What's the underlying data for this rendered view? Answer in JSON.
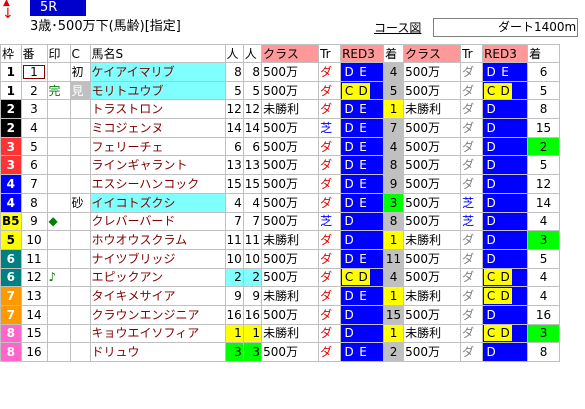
{
  "race": {
    "number": "5R",
    "condition": "3歳･500万下(馬齢)[指定]",
    "course_link": "コース図",
    "course": "ダート1400m"
  },
  "headers": [
    "枠",
    "番",
    "印",
    "C",
    "馬名S",
    "人",
    "人",
    "クラス",
    "Tr",
    "RED3",
    "着",
    "クラス",
    "Tr",
    "RED3",
    "着"
  ],
  "rows": [
    {
      "waku": "1",
      "waku_bg": "#ffffff",
      "waku_fg": "#000000",
      "ban": "1",
      "mark": "",
      "c": "初",
      "name": "ケイアイマリブ",
      "name_hl": "hl",
      "r1": "8",
      "r2": "8",
      "cls1": "500万",
      "tr1": "ダ",
      "red1": [
        "D",
        "E"
      ],
      "pos1": "4",
      "pos1_bg": "#c0c0c0",
      "cls2": "500万",
      "tr2": "ダ",
      "red2": [
        "D",
        "E"
      ],
      "pos2": "6",
      "pos2_bg": "#ffffff"
    },
    {
      "waku": "1",
      "waku_bg": "#ffffff",
      "waku_fg": "#000000",
      "ban": "2",
      "mark": "完",
      "c": "見",
      "name": "モリトユウブ",
      "name_hl": "hl",
      "r1": "5",
      "r2": "5",
      "cls1": "500万",
      "tr1": "ダ",
      "red1": [
        "C",
        "D"
      ],
      "pos1": "5",
      "pos1_bg": "#c0c0c0",
      "cls2": "500万",
      "tr2": "ダ",
      "red2": [
        "C",
        "D"
      ],
      "pos2": "5",
      "pos2_bg": "#ffffff"
    },
    {
      "waku": "2",
      "waku_bg": "#000000",
      "waku_fg": "#ffffff",
      "ban": "3",
      "mark": "",
      "c": "",
      "name": "トラストロン",
      "name_hl": "",
      "r1": "12",
      "r2": "12",
      "cls1": "未勝利",
      "tr1": "ダ",
      "red1": [
        "D",
        "E"
      ],
      "pos1": "1",
      "pos1_bg": "#ffff00",
      "cls2": "未勝利",
      "tr2": "ダ",
      "red2": [
        "D"
      ],
      "pos2": "8",
      "pos2_bg": "#ffffff"
    },
    {
      "waku": "2",
      "waku_bg": "#000000",
      "waku_fg": "#ffffff",
      "ban": "4",
      "mark": "",
      "c": "",
      "name": "ミコジェンヌ",
      "name_hl": "",
      "r1": "14",
      "r2": "14",
      "cls1": "500万",
      "tr1": "芝",
      "red1": [
        "D",
        "E"
      ],
      "pos1": "7",
      "pos1_bg": "#c0c0c0",
      "cls2": "500万",
      "tr2": "ダ",
      "red2": [
        "D"
      ],
      "pos2": "15",
      "pos2_bg": "#ffffff"
    },
    {
      "waku": "3",
      "waku_bg": "#ff3333",
      "waku_fg": "#ffffff",
      "ban": "5",
      "mark": "",
      "c": "",
      "name": "フェリーチェ",
      "name_hl": "",
      "r1": "6",
      "r2": "6",
      "cls1": "500万",
      "tr1": "ダ",
      "red1": [
        "D",
        "E"
      ],
      "pos1": "4",
      "pos1_bg": "#c0c0c0",
      "cls2": "500万",
      "tr2": "ダ",
      "red2": [
        "D"
      ],
      "pos2": "2",
      "pos2_bg": "#00ff00"
    },
    {
      "waku": "3",
      "waku_bg": "#ff3333",
      "waku_fg": "#ffffff",
      "ban": "6",
      "mark": "",
      "c": "",
      "name": "ラインギャラント",
      "name_hl": "",
      "r1": "13",
      "r2": "13",
      "cls1": "500万",
      "tr1": "ダ",
      "red1": [
        "D",
        "E"
      ],
      "pos1": "8",
      "pos1_bg": "#c0c0c0",
      "cls2": "500万",
      "tr2": "ダ",
      "red2": [
        "D"
      ],
      "pos2": "5",
      "pos2_bg": "#ffffff"
    },
    {
      "waku": "4",
      "waku_bg": "#0000ff",
      "waku_fg": "#ffffff",
      "ban": "7",
      "mark": "",
      "c": "",
      "name": "エスシーハンコック",
      "name_hl": "",
      "r1": "15",
      "r2": "15",
      "cls1": "500万",
      "tr1": "ダ",
      "red1": [
        "D",
        "E"
      ],
      "pos1": "9",
      "pos1_bg": "#c0c0c0",
      "cls2": "500万",
      "tr2": "ダ",
      "red2": [
        "D"
      ],
      "pos2": "12",
      "pos2_bg": "#ffffff"
    },
    {
      "waku": "4",
      "waku_bg": "#0000ff",
      "waku_fg": "#ffffff",
      "ban": "8",
      "mark": "",
      "c": "砂",
      "name": "イイコトズクシ",
      "name_hl": "hl",
      "r1": "4",
      "r2": "4",
      "cls1": "500万",
      "tr1": "ダ",
      "red1": [
        "D",
        "E"
      ],
      "pos1": "3",
      "pos1_bg": "#00ff00",
      "cls2": "500万",
      "tr2": "芝",
      "red2": [
        "D"
      ],
      "pos2": "14",
      "pos2_bg": "#ffffff"
    },
    {
      "waku": "B5",
      "waku_bg": "#ffff00",
      "waku_fg": "#000000",
      "ban": "9",
      "mark": "◆",
      "c": "",
      "name": "クレバーバード",
      "name_hl": "",
      "r1": "7",
      "r2": "7",
      "cls1": "500万",
      "tr1": "芝",
      "red1": [
        "D"
      ],
      "pos1": "8",
      "pos1_bg": "#c0c0c0",
      "cls2": "500万",
      "tr2": "芝",
      "red2": [
        "D"
      ],
      "pos2": "4",
      "pos2_bg": "#ffffff"
    },
    {
      "waku": "5",
      "waku_bg": "#ffff00",
      "waku_fg": "#000000",
      "ban": "10",
      "mark": "",
      "c": "",
      "name": "ホウオウスクラム",
      "name_hl": "",
      "r1": "11",
      "r2": "11",
      "cls1": "未勝利",
      "tr1": "ダ",
      "red1": [
        "D"
      ],
      "pos1": "1",
      "pos1_bg": "#ffff00",
      "cls2": "未勝利",
      "tr2": "ダ",
      "red2": [
        "D"
      ],
      "pos2": "3",
      "pos2_bg": "#00ff00"
    },
    {
      "waku": "6",
      "waku_bg": "#008080",
      "waku_fg": "#ffffff",
      "ban": "11",
      "mark": "",
      "c": "",
      "name": "ナイツブリッジ",
      "name_hl": "",
      "r1": "10",
      "r2": "10",
      "cls1": "500万",
      "tr1": "ダ",
      "red1": [
        "D",
        "E"
      ],
      "pos1": "11",
      "pos1_bg": "#c0c0c0",
      "cls2": "500万",
      "tr2": "ダ",
      "red2": [
        "D"
      ],
      "pos2": "5",
      "pos2_bg": "#ffffff"
    },
    {
      "waku": "6",
      "waku_bg": "#008080",
      "waku_fg": "#ffffff",
      "ban": "12",
      "mark": "♪",
      "c": "",
      "name": "エピックアン",
      "name_hl": "",
      "r1": "2",
      "r2": "2",
      "r_hl": "hl",
      "cls1": "500万",
      "tr1": "ダ",
      "red1": [
        "C",
        "D"
      ],
      "pos1": "4",
      "pos1_bg": "#c0c0c0",
      "cls2": "500万",
      "tr2": "ダ",
      "red2": [
        "C",
        "D"
      ],
      "pos2": "4",
      "pos2_bg": "#ffffff"
    },
    {
      "waku": "7",
      "waku_bg": "#ff9900",
      "waku_fg": "#ffffff",
      "ban": "13",
      "mark": "",
      "c": "",
      "name": "タイキメサイア",
      "name_hl": "",
      "r1": "9",
      "r2": "9",
      "cls1": "未勝利",
      "tr1": "ダ",
      "red1": [
        "D",
        "E"
      ],
      "pos1": "1",
      "pos1_bg": "#ffff00",
      "cls2": "未勝利",
      "tr2": "ダ",
      "red2": [
        "C",
        "D"
      ],
      "pos2": "4",
      "pos2_bg": "#ffffff"
    },
    {
      "waku": "7",
      "waku_bg": "#ff9900",
      "waku_fg": "#ffffff",
      "ban": "14",
      "mark": "",
      "c": "",
      "name": "クラウンエンジニア",
      "name_hl": "",
      "r1": "16",
      "r2": "16",
      "cls1": "500万",
      "tr1": "ダ",
      "red1": [
        "D"
      ],
      "pos1": "15",
      "pos1_bg": "#c0c0c0",
      "cls2": "500万",
      "tr2": "ダ",
      "red2": [
        "D"
      ],
      "pos2": "16",
      "pos2_bg": "#ffffff"
    },
    {
      "waku": "8",
      "waku_bg": "#ff66cc",
      "waku_fg": "#ffffff",
      "ban": "15",
      "mark": "",
      "c": "",
      "name": "キョウエイソフィア",
      "name_hl": "",
      "r1": "1",
      "r2": "1",
      "r_hl": "hy",
      "cls1": "未勝利",
      "tr1": "ダ",
      "red1": [
        "D"
      ],
      "pos1": "1",
      "pos1_bg": "#ffff00",
      "cls2": "未勝利",
      "tr2": "ダ",
      "red2": [
        "C",
        "D"
      ],
      "pos2": "3",
      "pos2_bg": "#00ff00"
    },
    {
      "waku": "8",
      "waku_bg": "#ff66cc",
      "waku_fg": "#ffffff",
      "ban": "16",
      "mark": "",
      "c": "",
      "name": "ドリュウ",
      "name_hl": "",
      "r1": "3",
      "r2": "3",
      "r_hl": "hg",
      "cls1": "500万",
      "tr1": "ダ",
      "red1": [
        "D",
        "E"
      ],
      "pos1": "2",
      "pos1_bg": "#c0c0c0",
      "cls2": "500万",
      "tr2": "ダ",
      "red2": [
        "D"
      ],
      "pos2": "8",
      "pos2_bg": "#ffffff"
    }
  ]
}
